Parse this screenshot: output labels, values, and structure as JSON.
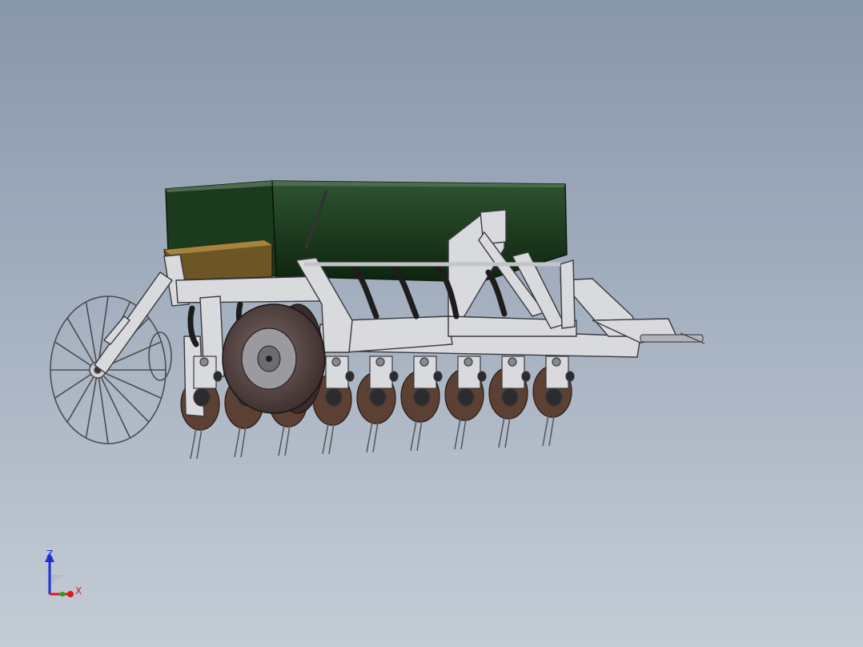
{
  "viewport": {
    "background_top": "#8896aa",
    "background_bottom": "#c4ccd6"
  },
  "model": {
    "hopper_color": "#1e3d1f",
    "frame_color": "#d9dade",
    "disc_color": "#5b4033",
    "tire_color": "#4a3a38",
    "box_color": "#6e5526",
    "row_units": 9
  },
  "triad": {
    "z_label": "Z",
    "x_label": "X",
    "z_color": "#1b2fd8",
    "x_color": "#e01b1b",
    "y_color": "#1ea51e"
  }
}
